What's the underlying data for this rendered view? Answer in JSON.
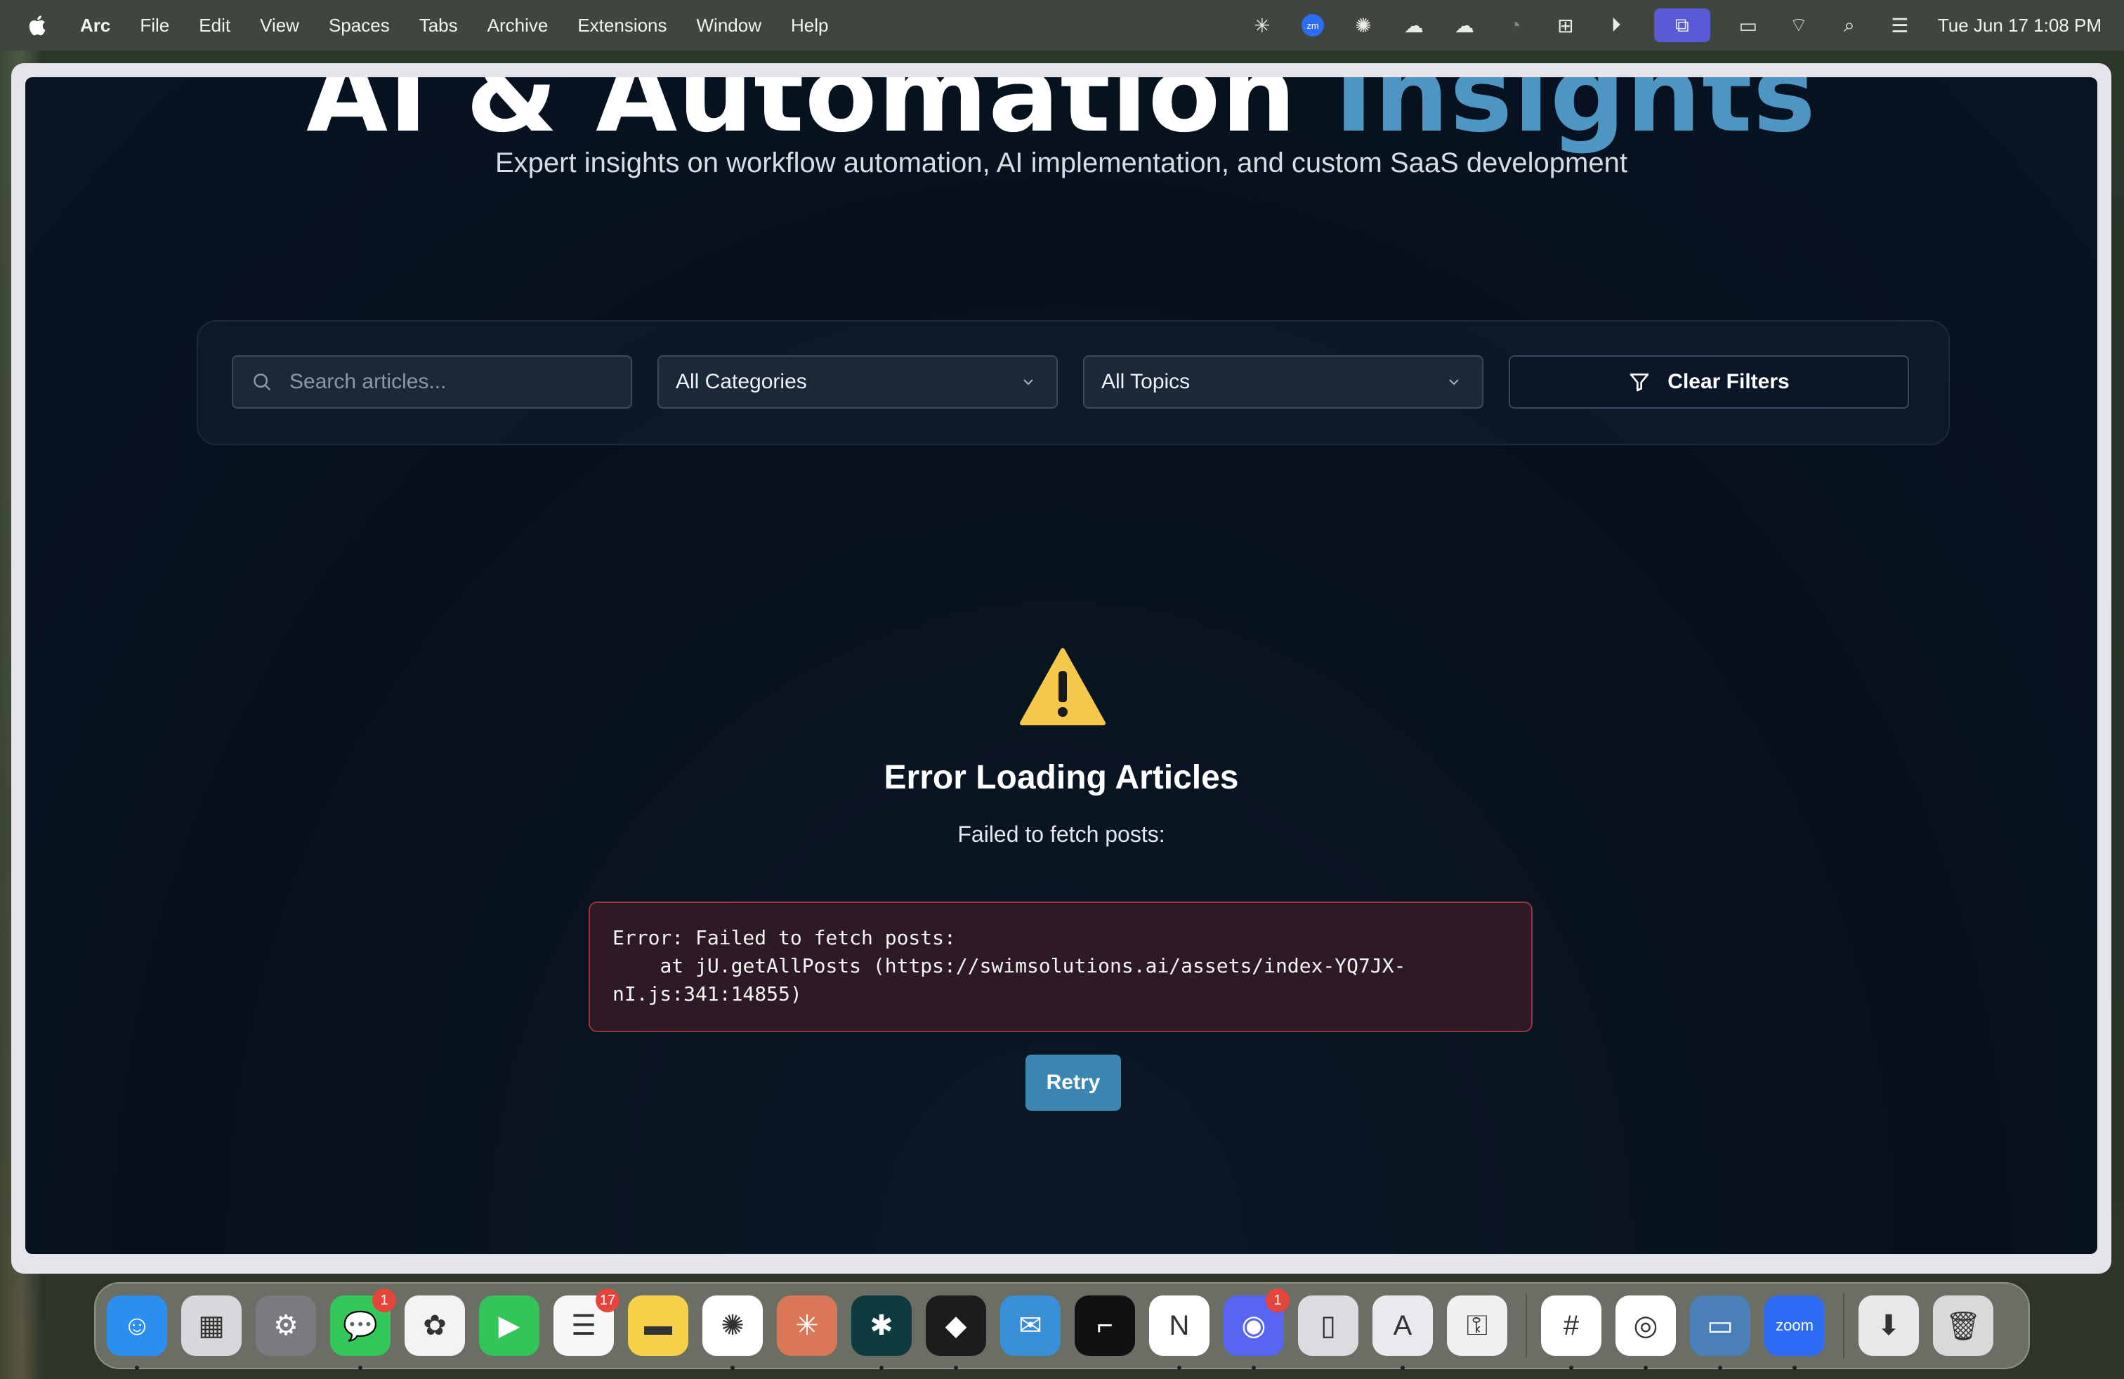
{
  "menubar": {
    "app_name": "Arc",
    "items": [
      "File",
      "Edit",
      "View",
      "Spaces",
      "Tabs",
      "Archive",
      "Extensions",
      "Window",
      "Help"
    ],
    "status_icons": [
      "perplexity-icon",
      "zoom-status-icon",
      "chatgpt-icon",
      "icloud-icon",
      "cloud-check-icon",
      "loader-icon",
      "grid-icon",
      "play-icon",
      "screen-mirror-icon",
      "battery-icon",
      "wifi-icon",
      "spotlight-icon",
      "control-center-icon"
    ],
    "clock": "Tue Jun 17  1:08 PM"
  },
  "page": {
    "hero_title_main": "AI & Automation ",
    "hero_title_accent": "Insights",
    "hero_subtitle": "Expert insights on workflow automation, AI implementation, and custom SaaS development",
    "filters": {
      "search_placeholder": "Search articles...",
      "category_value": "All Categories",
      "topic_value": "All Topics",
      "clear_label": "Clear Filters"
    },
    "error": {
      "title": "Error Loading Articles",
      "message": "Failed to fetch posts:",
      "details": "Error: Failed to fetch posts:\n    at jU.getAllPosts (https://swimsolutions.ai/assets/index-YQ7JX-\nnI.js:341:14855)",
      "retry_label": "Retry"
    }
  },
  "dock": {
    "apps": [
      {
        "name": "finder",
        "color": "#2a8ff0"
      },
      {
        "name": "launchpad",
        "color": "#d8d8dc"
      },
      {
        "name": "system-settings",
        "color": "#7a7a80"
      },
      {
        "name": "messages",
        "color": "#34c759",
        "badge": "1"
      },
      {
        "name": "photos",
        "color": "#f3f3f3"
      },
      {
        "name": "facetime",
        "color": "#33c45a"
      },
      {
        "name": "reminders",
        "color": "#f7f7f7",
        "badge": "17"
      },
      {
        "name": "notes",
        "color": "#f5d24a"
      },
      {
        "name": "chatgpt",
        "color": "#ffffff"
      },
      {
        "name": "claude",
        "color": "#d97757"
      },
      {
        "name": "perplexity",
        "color": "#0f3b40"
      },
      {
        "name": "replit",
        "color": "#1c1c1c"
      },
      {
        "name": "airmail",
        "color": "#3a8fd9"
      },
      {
        "name": "linear-capture",
        "color": "#111111"
      },
      {
        "name": "notion",
        "color": "#ffffff"
      },
      {
        "name": "discord",
        "color": "#5865f2",
        "badge": "1"
      },
      {
        "name": "iphone-mirroring",
        "color": "#dcdce0"
      },
      {
        "name": "arc-like-app",
        "color": "#e9e9ee"
      },
      {
        "name": "passwords",
        "color": "#f0f0f0"
      },
      {
        "name": "slack",
        "color": "#ffffff"
      },
      {
        "name": "chrome",
        "color": "#ffffff"
      },
      {
        "name": "screen-sharing",
        "color": "#4a7fb8"
      },
      {
        "name": "zoom",
        "color": "#2d6cf5",
        "label": "zoom"
      },
      {
        "name": "downloads-stack",
        "color": "#e8e8e8"
      },
      {
        "name": "trash",
        "color": "#d9d9dc"
      }
    ]
  }
}
